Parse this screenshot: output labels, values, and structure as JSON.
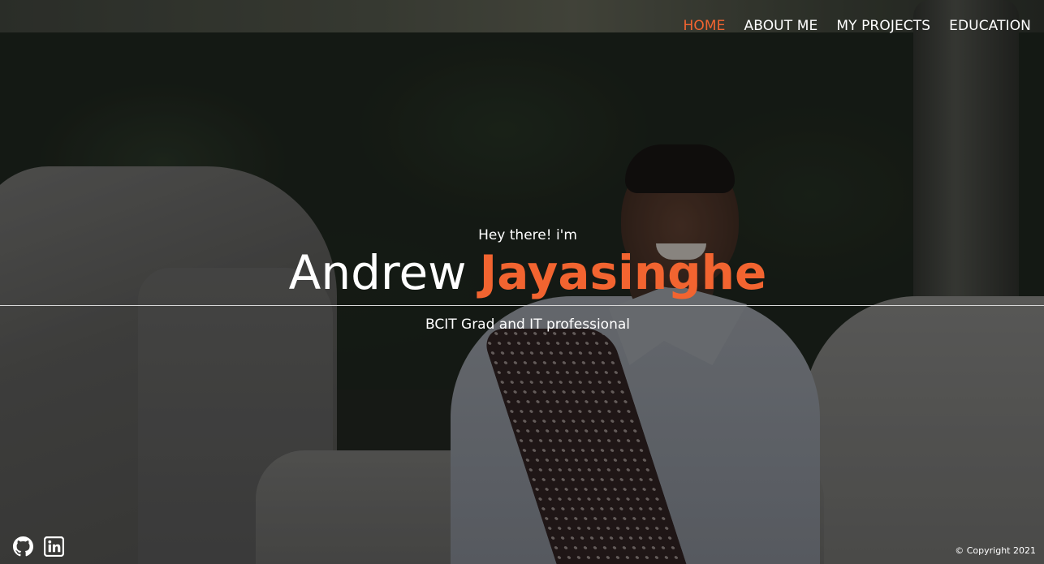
{
  "nav": {
    "items": [
      {
        "label": "HOME",
        "active": true
      },
      {
        "label": "ABOUT ME",
        "active": false
      },
      {
        "label": "MY PROJECTS",
        "active": false
      },
      {
        "label": "EDUCATION",
        "active": false
      }
    ]
  },
  "hero": {
    "greeting": "Hey there! i'm",
    "first_name": "Andrew",
    "last_name": "Jayasinghe",
    "tagline": "BCIT Grad and IT professional"
  },
  "footer": {
    "social": [
      {
        "icon": "github-icon"
      },
      {
        "icon": "linkedin-icon"
      }
    ],
    "copyright": "© Copyright 2021"
  },
  "colors": {
    "accent": "#f26430",
    "text": "#ffffff"
  }
}
